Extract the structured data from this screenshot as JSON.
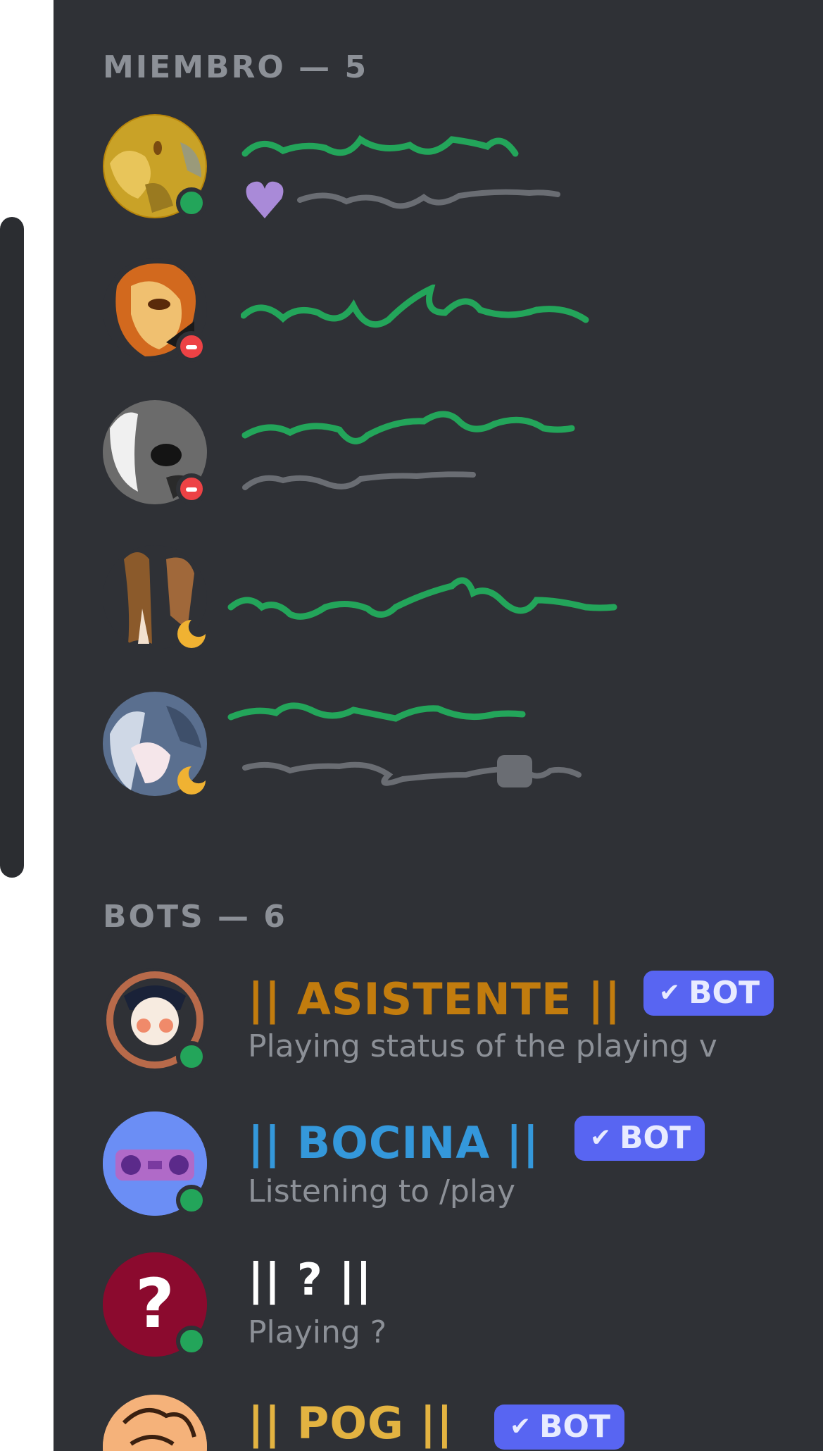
{
  "members_header": "MIEMBRO — 5",
  "bots_header": "BOTS — 6",
  "colors": {
    "panel_bg": "#2f3136",
    "name_green": "#23a55a",
    "status_grey": "#6a6d73",
    "online": "#23a55a",
    "dnd": "#ed4245",
    "idle": "#f0b232",
    "bot_badge": "#5865f2"
  },
  "bots": [
    {
      "name": "|| ASISTENTE ||",
      "name_color": "#c27c0e",
      "badge": "BOT",
      "status": "Playing status of the playing v",
      "presence": "online"
    },
    {
      "name": "|| BOCINA ||",
      "name_color": "#3498db",
      "badge": "BOT",
      "status": "Listening to /play",
      "presence": "online"
    },
    {
      "name": "|| ? ||",
      "name_color": "#ffffff",
      "badge": "",
      "status": "Playing ?",
      "presence": "online"
    },
    {
      "name": "|| POG ||",
      "name_color": "#e3b341",
      "badge": "BOT",
      "status": "",
      "presence": "online"
    }
  ],
  "icons": {
    "heart": "heart-icon",
    "screen": "screen-share-icon",
    "check": "verified-check-icon"
  }
}
